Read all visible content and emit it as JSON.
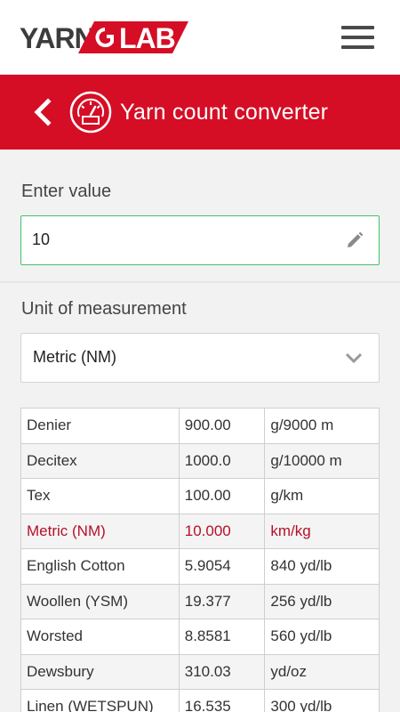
{
  "brand": {
    "logo_text_left": "YARN",
    "logo_text_right": "LAB",
    "accent_color": "#d50e25"
  },
  "header": {
    "menu_icon": "hamburger-menu-icon"
  },
  "titlebar": {
    "back_icon": "chevron-left-icon",
    "tool_icon": "gauge-icon",
    "title": "Yarn count converter"
  },
  "form": {
    "value_label": "Enter value",
    "value": "10",
    "value_edit_icon": "pencil-icon",
    "unit_label": "Unit of measurement",
    "unit_selected": "Metric (NM)",
    "unit_dropdown_icon": "chevron-down-icon"
  },
  "results": {
    "rows": [
      {
        "name": "Denier",
        "value": "900.00",
        "unit": "g/9000 m",
        "active": false
      },
      {
        "name": "Decitex",
        "value": "1000.0",
        "unit": "g/10000 m",
        "active": false
      },
      {
        "name": "Tex",
        "value": "100.00",
        "unit": "g/km",
        "active": false
      },
      {
        "name": "Metric (NM)",
        "value": "10.000",
        "unit": "km/kg",
        "active": true
      },
      {
        "name": "English Cotton",
        "value": "5.9054",
        "unit": "840 yd/lb",
        "active": false
      },
      {
        "name": "Woollen (YSM)",
        "value": "19.377",
        "unit": "256 yd/lb",
        "active": false
      },
      {
        "name": "Worsted",
        "value": "8.8581",
        "unit": "560 yd/lb",
        "active": false
      },
      {
        "name": "Dewsbury",
        "value": "310.03",
        "unit": "yd/oz",
        "active": false
      },
      {
        "name": "Linen (WETSPUN)",
        "value": "16.535",
        "unit": "300 yd/lb",
        "active": false
      }
    ]
  }
}
